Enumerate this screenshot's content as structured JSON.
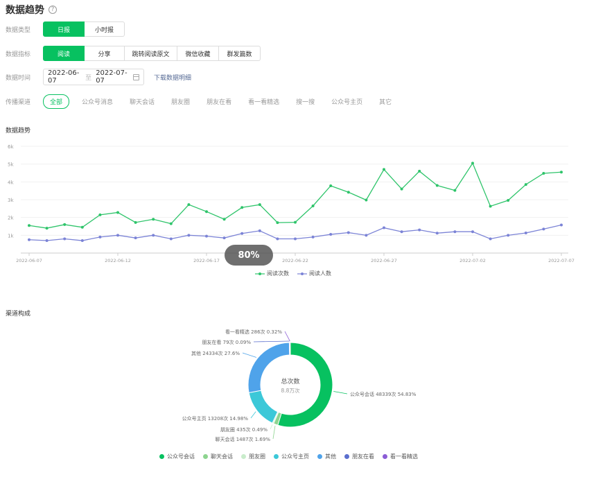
{
  "header": {
    "title": "数据趋势",
    "help_icon": "?"
  },
  "filters": {
    "data_type": {
      "label": "数据类型",
      "options": [
        "日报",
        "小时报"
      ],
      "selected": "日报"
    },
    "metric": {
      "label": "数据指标",
      "options": [
        "阅读",
        "分享",
        "跳转阅读原文",
        "微信收藏",
        "群发篇数"
      ],
      "selected": "阅读"
    },
    "time": {
      "label": "数据时间",
      "start": "2022-06-07",
      "to": "至",
      "end": "2022-07-07",
      "download": "下载数据明细"
    },
    "channel": {
      "label": "传播渠道",
      "options": [
        "全部",
        "公众号消息",
        "聊天会话",
        "朋友圈",
        "朋友在看",
        "看一看精选",
        "搜一搜",
        "公众号主页",
        "其它"
      ],
      "selected": "全部"
    }
  },
  "trend_title": "数据趋势",
  "progress_badge": "80%",
  "channel_title": "渠道构成",
  "colors": {
    "accent": "#07c160",
    "series_reads": "#2ec46a",
    "series_users": "#7b83d6"
  },
  "chart_data": [
    {
      "type": "line",
      "title": "数据趋势",
      "x": [
        "2022-06-07",
        "2022-06-08",
        "2022-06-09",
        "2022-06-10",
        "2022-06-11",
        "2022-06-12",
        "2022-06-13",
        "2022-06-14",
        "2022-06-15",
        "2022-06-16",
        "2022-06-17",
        "2022-06-18",
        "2022-06-19",
        "2022-06-20",
        "2022-06-21",
        "2022-06-22",
        "2022-06-23",
        "2022-06-24",
        "2022-06-25",
        "2022-06-26",
        "2022-06-27",
        "2022-06-28",
        "2022-06-29",
        "2022-06-30",
        "2022-07-01",
        "2022-07-02",
        "2022-07-03",
        "2022-07-04",
        "2022-07-05",
        "2022-07-06",
        "2022-07-07"
      ],
      "x_ticks": [
        "2022-06-07",
        "2022-06-12",
        "2022-06-17",
        "2022-06-22",
        "2022-06-27",
        "2022-07-02",
        "2022-07-07"
      ],
      "y_ticks": [
        "6k",
        "5k",
        "4k",
        "3k",
        "2k",
        "1k"
      ],
      "ylim": [
        0,
        6000
      ],
      "series": [
        {
          "name": "阅读次数",
          "color": "#2ec46a",
          "values": [
            1550,
            1400,
            1600,
            1450,
            2150,
            2280,
            1720,
            1900,
            1650,
            2720,
            2330,
            1900,
            2560,
            2720,
            1710,
            1730,
            2650,
            3780,
            3420,
            2980,
            4700,
            3600,
            4600,
            3800,
            3520,
            5050,
            2630,
            2960,
            3850,
            4480,
            4550
          ]
        },
        {
          "name": "阅读人数",
          "color": "#7b83d6",
          "values": [
            750,
            700,
            800,
            700,
            900,
            1000,
            850,
            1000,
            800,
            1000,
            950,
            850,
            1100,
            1250,
            800,
            800,
            900,
            1050,
            1150,
            1000,
            1420,
            1200,
            1300,
            1120,
            1200,
            1200,
            800,
            1000,
            1130,
            1350,
            1580
          ]
        }
      ],
      "legend_position": "bottom",
      "grid": true
    },
    {
      "type": "pie",
      "title": "渠道构成",
      "center_title": "总次数",
      "center_value": "8.8万次",
      "slices": [
        {
          "name": "公众号会话",
          "count": "48339次",
          "percent": 54.83,
          "label": "公众号会话 48339次 54.83%",
          "color": "#07c160"
        },
        {
          "name": "聊天会话",
          "count": "1487次",
          "percent": 1.69,
          "label": "聊天会话 1487次 1.69%",
          "color": "#8dd48f"
        },
        {
          "name": "朋友圈",
          "count": "435次",
          "percent": 0.49,
          "label": "朋友圈 435次 0.49%",
          "color": "#c9eccb"
        },
        {
          "name": "公众号主页",
          "count": "13208次",
          "percent": 14.98,
          "label": "公众号主页 13208次 14.98%",
          "color": "#3cc8d8"
        },
        {
          "name": "其他",
          "count": "24334次",
          "percent": 27.6,
          "label": "其他 24334次 27.6%",
          "color": "#4fa3ea"
        },
        {
          "name": "朋友在看",
          "count": "79次",
          "percent": 0.09,
          "label": "朋友在看 79次 0.09%",
          "color": "#5b6fce"
        },
        {
          "name": "看一看精选",
          "count": "286次",
          "percent": 0.32,
          "label": "看一看精选 286次 0.32%",
          "color": "#8b5cd6"
        }
      ],
      "legend": [
        "公众号会话",
        "聊天会话",
        "朋友圈",
        "公众号主页",
        "其他",
        "朋友在看",
        "看一看精选"
      ],
      "legend_position": "bottom"
    }
  ]
}
